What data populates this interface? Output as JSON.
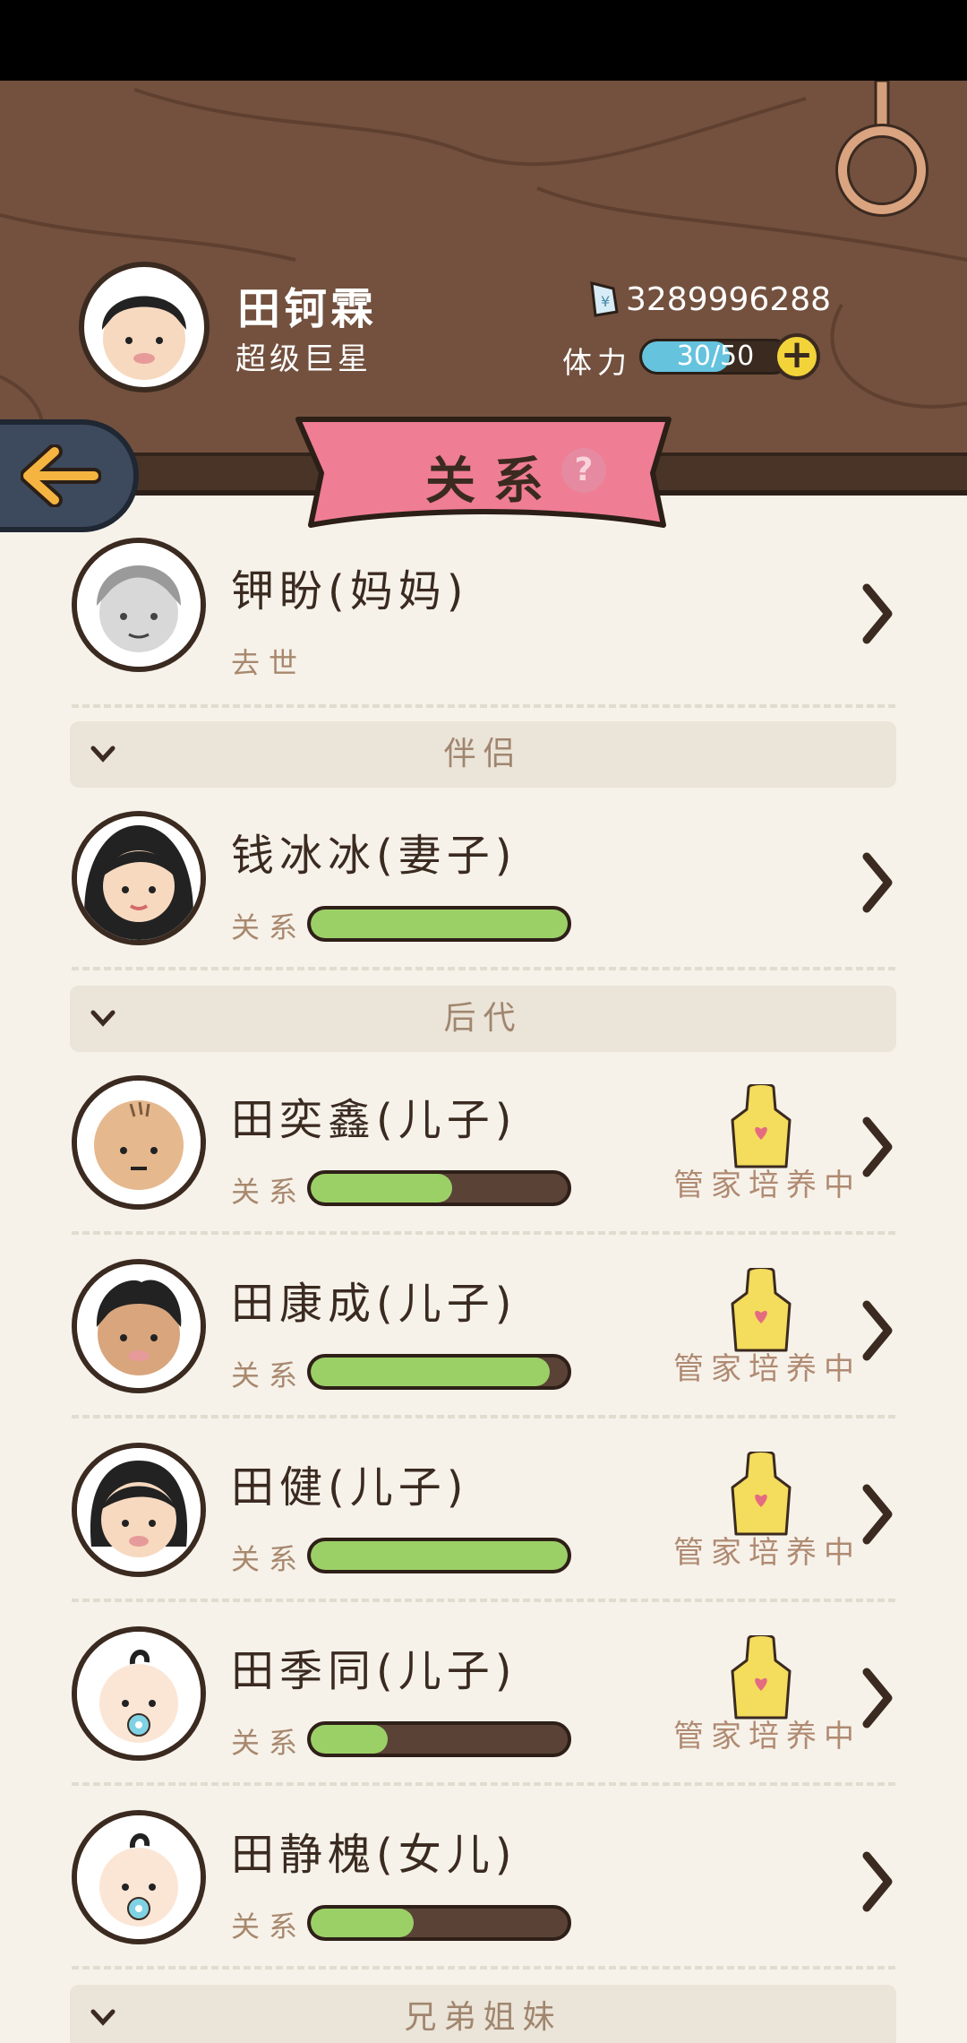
{
  "header": {
    "player_name": "田钶霖",
    "player_title": "超级巨星",
    "money": "3289996288",
    "stamina_label": "体力",
    "stamina_text": "30/50",
    "stamina_current": 30,
    "stamina_max": 50,
    "plus_label": "+"
  },
  "banner": {
    "title": "关系",
    "help": "?"
  },
  "relation_label": "关系",
  "butler_label": "管家培养中",
  "rows_top": [
    {
      "name": "钾盼(妈妈)",
      "status": "去世"
    }
  ],
  "sections": [
    {
      "label": "伴侣"
    },
    {
      "label": "后代"
    },
    {
      "label": "兄弟姐妹"
    }
  ],
  "partner": {
    "name": "钱冰冰(妻子)",
    "relation": 1.0
  },
  "children": [
    {
      "name": "田奕鑫(儿子)",
      "relation": 0.55,
      "butler": true
    },
    {
      "name": "田康成(儿子)",
      "relation": 0.93,
      "butler": true
    },
    {
      "name": "田健(儿子)",
      "relation": 1.0,
      "butler": true
    },
    {
      "name": "田季同(儿子)",
      "relation": 0.3,
      "butler": true
    },
    {
      "name": "田静槐(女儿)",
      "relation": 0.4,
      "butler": false
    }
  ],
  "colors": {
    "wood": "#73513e",
    "bar_fill": "#9bd067",
    "bar_bg": "#5a4336",
    "banner": "#ef7d93",
    "stamina": "#65c3de",
    "background": "#f6f2ea"
  }
}
